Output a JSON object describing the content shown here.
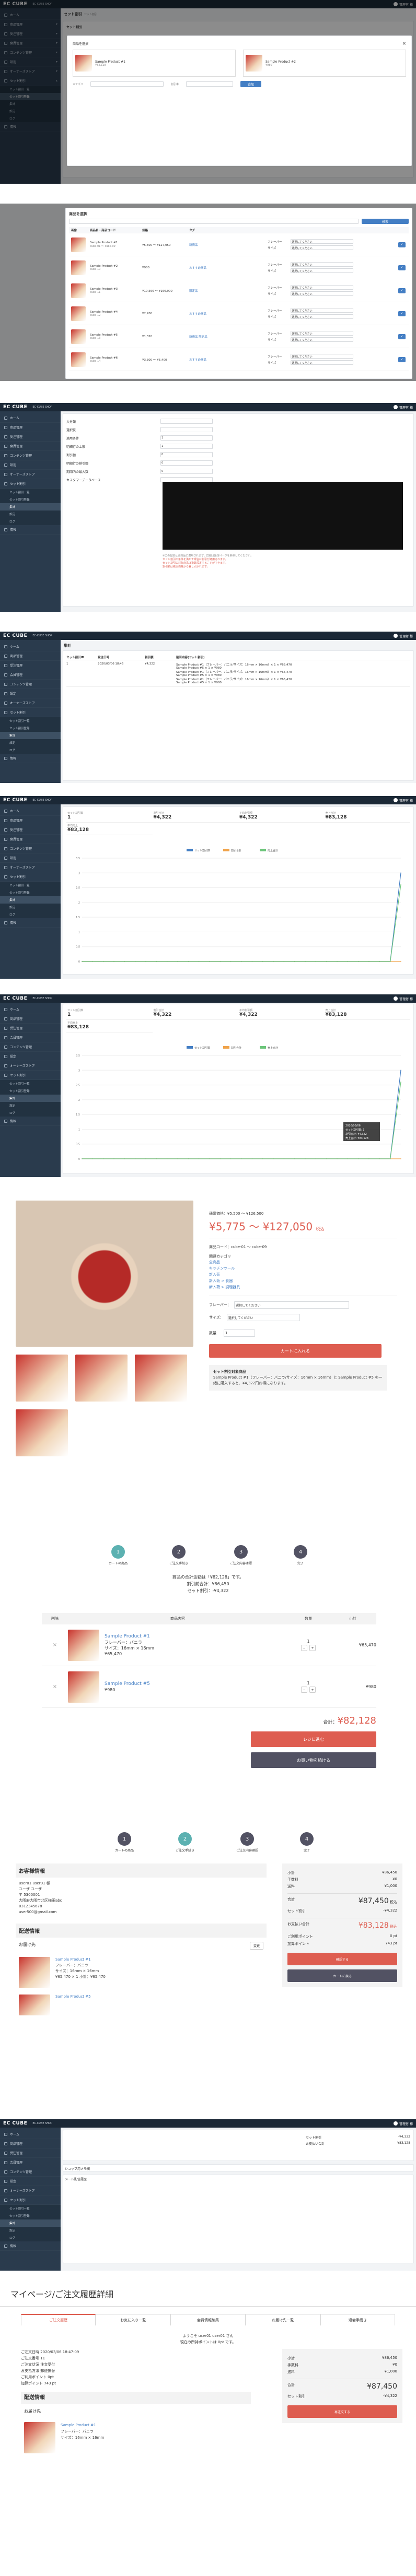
{
  "common": {
    "brand": "EC CUBE",
    "shop_name": "EC-CUBE SHOP",
    "user_name": "管理者 様",
    "sidebar": [
      "ホーム",
      "商品管理",
      "受注管理",
      "会員管理",
      "コンテンツ管理",
      "設定",
      "オーナーズストア",
      "セット割引",
      "情報"
    ],
    "sidebar_sub": [
      "セット割引一覧",
      "セット割引登録",
      "集計",
      "設定",
      "ログ"
    ]
  },
  "p1": {
    "title": "セット割引",
    "subtitle": "セット割引",
    "modal_title": "商品を選択",
    "card_title": "セット割引",
    "search_label": "カテゴリ",
    "product_a": "Sample Product #1",
    "product_b": "Sample Product #2",
    "price_a": "¥82,128",
    "price_b": "¥980",
    "label_set": "商品を選択",
    "select_placeholder": "選択してください",
    "discount_label": "割引率",
    "btn_add": "追加"
  },
  "p2": {
    "title": "商品を選択",
    "search_placeholder": "キーワード",
    "search_button": "検索",
    "col_img": "画像",
    "col_name": "商品名・商品コード",
    "col_price": "価格",
    "col_tag": "タグ",
    "col_opt": "",
    "rows": [
      {
        "name": "Sample Product #1",
        "code": "cube-01 ～ cube-09",
        "price": "¥5,500 ～ ¥127,050",
        "tag": "新商品"
      },
      {
        "name": "Sample Product #2",
        "code": "cube-10",
        "price": "¥980",
        "tag": "おすすめ商品"
      },
      {
        "name": "Sample Product #3",
        "code": "cube-11",
        "price": "¥10,560 ～ ¥166,900",
        "tag": "限定品"
      },
      {
        "name": "Sample Product #4",
        "code": "cube-12",
        "price": "¥2,200",
        "tag": "おすすめ商品"
      },
      {
        "name": "Sample Product #5",
        "code": "cube-13",
        "price": "¥1,320",
        "tag": "新商品 限定品"
      },
      {
        "name": "Sample Product #6",
        "code": "cube-14",
        "price": "¥3,300 ～ ¥5,400",
        "tag": "おすすめ商品"
      }
    ],
    "side_labels": [
      "フレーバー",
      "サイズ"
    ],
    "side_select": "選択してください"
  },
  "p3": {
    "rows": [
      {
        "k": "大分類",
        "v": ""
      },
      {
        "k": "選択肢",
        "v": ""
      },
      {
        "k": "適用条件",
        "v": "1"
      },
      {
        "k": "明細行の上限",
        "v": "1"
      },
      {
        "k": "割引額",
        "v": "0"
      },
      {
        "k": "明細行の割引額",
        "v": "0"
      },
      {
        "k": "期間内の最大数",
        "v": "0"
      },
      {
        "k": "カスタマーデータベース",
        "v": ""
      }
    ],
    "notes": [
      "※この設定は全商品に適用されます。詳細は設定ページを参照してください。",
      "セット割引の条件を満たす場合に割引が適用されます。",
      "セット割引の対象商品は複数設定することができます。",
      "割引額は税込価格から差し引かれます。"
    ]
  },
  "p4": {
    "title": "集計",
    "col1": "セット割引ID",
    "col2": "受注日時",
    "col3": "割引額",
    "col4": "割引内容(セット割引)",
    "date": "2020/03/06 18:46",
    "id": "1",
    "amount": "¥4,322",
    "lines": [
      "Sample Product #1（フレーバー：バニラ/サイズ：16mm × 16mm）× 1 × ¥65,470",
      "Sample Product #5 × 1 × ¥980",
      "Sample Product #1（フレーバー：バニラ/サイズ：16mm × 16mm）× 1 × ¥65,470",
      "Sample Product #5 × 1 × ¥980",
      "Sample Product #1（フレーバー：バニラ/サイズ：16mm × 16mm）× 1 × ¥65,470",
      "Sample Product #5 × 1 × ¥980"
    ]
  },
  "stats": {
    "k1": "セット割引数",
    "v1": "1",
    "k2": "割引合計",
    "v2": "¥4,322",
    "k3": "平均割引額",
    "v3": "¥4,322",
    "k4": "売上合計",
    "v4": "¥83,128",
    "k5": "平均売上",
    "v5": "¥83,128"
  },
  "chart_data": {
    "type": "line",
    "title": "",
    "legend": [
      "セット割引数",
      "割引合計",
      "売上合計"
    ],
    "ylim": [
      0,
      3.5
    ],
    "yticks": [
      "3.5",
      "3",
      "2.5",
      "2",
      "1.5",
      "1",
      "0.5",
      "0"
    ],
    "series": [
      {
        "name": "セット割引数",
        "values": [
          0,
          0,
          0,
          0,
          0,
          0,
          0,
          0,
          0,
          0,
          0,
          0,
          0,
          0,
          0,
          0,
          0,
          0,
          0,
          0,
          0,
          0,
          0,
          0,
          0,
          0,
          0,
          0,
          0,
          0,
          3
        ]
      },
      {
        "name": "割引合計",
        "values": [
          0,
          0,
          0,
          0,
          0,
          0,
          0,
          0,
          0,
          0,
          0,
          0,
          0,
          0,
          0,
          0,
          0,
          0,
          0,
          0,
          0,
          0,
          0,
          0,
          0,
          0,
          0,
          0,
          0,
          0,
          0
        ]
      },
      {
        "name": "売上合計",
        "values": [
          0,
          0,
          0,
          0,
          0,
          0,
          0,
          0,
          0,
          0,
          0,
          0,
          0,
          0,
          0,
          0,
          0,
          0,
          0,
          0,
          0,
          0,
          0,
          0,
          0,
          0,
          0,
          0,
          0,
          0,
          2.6
        ]
      }
    ],
    "tooltip": [
      "2020/03/06",
      "セット割引数: 1",
      "割引合計: ¥4,322",
      "売上合計: ¥83,128"
    ]
  },
  "product": {
    "price_normal": "通常価格：¥5,500 ～ ¥126,500",
    "price_label": "税込",
    "price": "¥5,775 ～ ¥127,050",
    "price_tax": "税込",
    "code": "商品コード：cube-01 ～ cube-09",
    "cat_title": "関連カテゴリ",
    "cats": [
      "全商品",
      "キッチンツール",
      "新入荷",
      "新入荷 > 食器",
      "新入荷 > 調理器具"
    ],
    "flavor_label": "フレーバー：",
    "size_label": "サイズ：",
    "select": "選択してください",
    "qty_label": "数量",
    "qty": "1",
    "cart_btn": "カートに入れる",
    "set_title": "セット割引対象商品",
    "set_text": "Sample Product #1（フレーバー：バニラ/サイズ：16mm × 16mm）と Sample Product #5 を一緒に購入すると、¥4,322円お得になります。"
  },
  "cart": {
    "steps": [
      "カートの商品",
      "ご注文手続き",
      "ご注文内容確認",
      "完了"
    ],
    "sum1": "商品の合計金額は「¥82,128」です。",
    "sum2": "割引前合計：¥86,450",
    "sum3": "セット割引：-¥4,322",
    "col_del": "削除",
    "col_item": "商品内容",
    "col_qty": "数量",
    "col_sub": "小計",
    "items": [
      {
        "name": "Sample Product #1",
        "d1": "フレーバー：バニラ",
        "d2": "サイズ：16mm × 16mm",
        "price": "¥65,470",
        "qty": "1",
        "sub": "¥65,470"
      },
      {
        "name": "Sample Product #5",
        "d1": "",
        "d2": "",
        "price": "¥980",
        "qty": "1",
        "sub": "¥980"
      }
    ],
    "total_label": "合計：",
    "total": "¥82,128",
    "btn_checkout": "レジに進む",
    "btn_continue": "お買い物を続ける"
  },
  "checkout": {
    "steps": [
      "カートの商品",
      "ご注文手続き",
      "ご注文内容確認",
      "完了"
    ],
    "h_customer": "お客様情報",
    "lines": [
      "user01 user01 様",
      "ユーザ ユーザ",
      "〒 5300001",
      "大阪府大阪市北区梅田abc",
      "0312345678",
      "user500@gmail.com"
    ],
    "h_delivery": "配送情報",
    "h_dest": "お届け先",
    "change": "変更",
    "item1": "Sample Product #1",
    "item1_d": "フレーバー：バニラ",
    "item1_d2": "サイズ：16mm × 16mm",
    "item1_p": "¥65,470 × 1 小計：¥65,470",
    "item2": "Sample Product #5",
    "sum": [
      {
        "k": "小計",
        "v": "¥86,450"
      },
      {
        "k": "手数料",
        "v": "¥0"
      },
      {
        "k": "送料",
        "v": "¥1,000"
      }
    ],
    "total_label": "合計",
    "total": "¥87,450",
    "total_tax": "税込",
    "set_label": "セット割引",
    "set_v": "-¥4,322",
    "pay_label": "お支払い合計",
    "pay": "¥83,128",
    "pay_tax": "税込",
    "pt_label": "ご利用ポイント",
    "pt": "0 pt",
    "pt2_label": "加算ポイント",
    "pt2": "743 pt",
    "btn_confirm": "確認する",
    "btn_back": "カートに戻る"
  },
  "order_admin": {
    "rows": [
      {
        "k": "セット割引",
        "v": "-¥4,322"
      },
      {
        "k": "お支払い合計",
        "v": "¥83,128"
      }
    ],
    "right_lines": [
      "加算ポイント",
      "ご利用ポイント",
      "743"
    ],
    "section1": "ショップ用メモ欄",
    "section2": "メール配信履歴"
  },
  "mypage": {
    "title": "マイページ/ご注文履歴詳細",
    "tabs": [
      "ご注文履歴",
      "お気に入り一覧",
      "会員情報編集",
      "お届け先一覧",
      "退会手続き"
    ],
    "welcome": "ようこそ user01 user01 さん",
    "points": "現在の所持ポイントは 0pt です。",
    "order_date": "ご注文日時 2020/03/06 18:47:09",
    "order_no": "ご注文番号 11",
    "status": "ご注文状況 注文受付",
    "pay": "お支払方法 郵便振替",
    "pt_use": "ご利用ポイント 0pt",
    "pt_add": "加算ポイント 743 pt",
    "h_delivery": "配送情報",
    "h_dest": "お届け先",
    "item1": "Sample Product #1",
    "item1_d": "フレーバー：バニラ",
    "item1_d2": "サイズ：16mm × 16mm",
    "sum": [
      {
        "k": "小計",
        "v": "¥86,450"
      },
      {
        "k": "手数料",
        "v": "¥0"
      },
      {
        "k": "送料",
        "v": "¥1,000"
      }
    ],
    "total_label": "合計",
    "total": "¥87,450",
    "set_label": "セット割引",
    "set_v": "-¥4,322",
    "btn": "再注文する"
  }
}
